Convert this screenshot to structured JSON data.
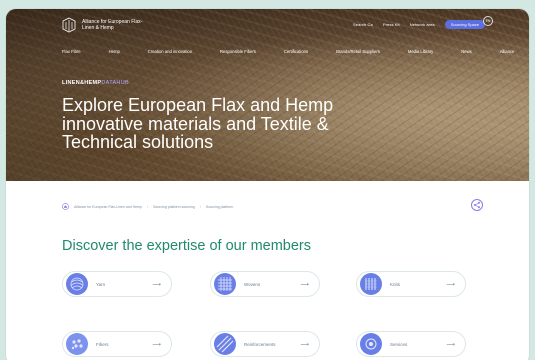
{
  "header": {
    "logo_text": "Alliance for European Flax-Linen & Hemp",
    "utility_links": [
      "Search Ca",
      "Press Kit",
      "Network area",
      "Sourcing Space"
    ],
    "language": "EN"
  },
  "nav": {
    "items": [
      "Flax Fibre",
      "Hemp",
      "Creation and innovation",
      "Responsible Fibers",
      "Certifications",
      "Brands/Retail Suppliers",
      "Media Library",
      "News",
      "Alliance"
    ]
  },
  "hero": {
    "eyebrow_main": "LINEN&HEMP",
    "eyebrow_accent": "DATAHUB",
    "title": "Explore European Flax and Hemp innovative materials and Textile & Technical solutions"
  },
  "breadcrumb": {
    "items": [
      "Alliance for European Flax-Linen and Hemp",
      "Sourcing platform sourcing",
      "Sourcing platform"
    ]
  },
  "main": {
    "title": "Discover the expertise of our members"
  },
  "cards": [
    {
      "label": "Yarn",
      "icon": "yarn-icon"
    },
    {
      "label": "Wovens",
      "icon": "wovens-icon"
    },
    {
      "label": "Knits",
      "icon": "knits-icon"
    },
    {
      "label": "Fibers",
      "icon": "fibers-icon"
    },
    {
      "label": "Reinforcements",
      "icon": "reinforcements-icon"
    },
    {
      "label": "Services",
      "icon": "services-icon"
    }
  ],
  "colors": {
    "background": "#d3e8e3",
    "accent_green": "#1f8a6d",
    "accent_purple": "#5b6fe0",
    "thumb_blue": "#6a7fe6"
  }
}
